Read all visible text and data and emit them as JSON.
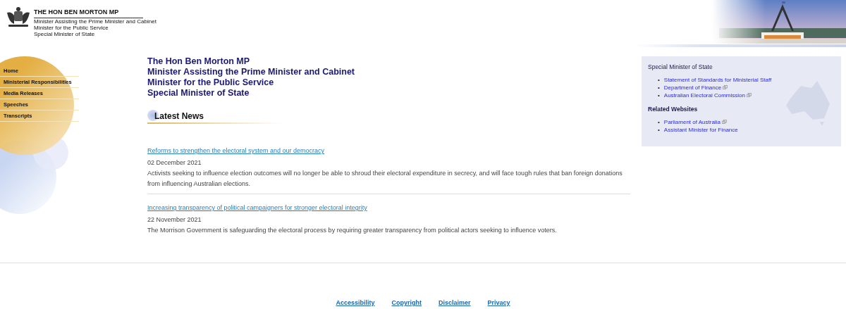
{
  "header": {
    "title": "THE HON BEN MORTON MP",
    "subtitles": [
      "Minister Assisting the Prime Minister and Cabinet",
      "Minister for the Public Service",
      "Special Minister of State"
    ]
  },
  "nav": [
    {
      "label": "Home"
    },
    {
      "label": "Ministerial Responsibilities"
    },
    {
      "label": "Media Releases"
    },
    {
      "label": "Speeches"
    },
    {
      "label": "Transcripts"
    }
  ],
  "main": {
    "titles": [
      "The Hon Ben Morton MP",
      "Minister Assisting the Prime Minister and Cabinet",
      "Minister for the Public Service",
      "Special Minister of State"
    ],
    "section_heading": "Latest News",
    "news": [
      {
        "title": "Reforms to strengthen the electoral system and our democracy",
        "date": "02 December 2021",
        "summary": "Activists seeking to influence election outcomes will no longer be able to shroud their electoral expenditure in secrecy, and will face tough rules that ban foreign donations from influencing Australian elections."
      },
      {
        "title": "Increasing transparency of political campaigners for stronger electoral integrity",
        "date": "22 November 2021",
        "summary": "The Morrison Government is safeguarding the electoral process by requiring greater transparency from political actors seeking to influence voters."
      }
    ]
  },
  "sidebar": {
    "groups": [
      {
        "heading": "Special Minister of State",
        "bold": false,
        "links": [
          {
            "bullet": "•",
            "label": "Statement of Standards for Ministerial Staff",
            "external": false
          },
          {
            "bullet": "•",
            "label": "Department of Finance",
            "external": true
          },
          {
            "bullet": "•",
            "label": "Australian Electoral Commission",
            "external": true
          }
        ]
      },
      {
        "heading": "Related Websites",
        "bold": true,
        "links": [
          {
            "bullet": "•",
            "label": "Parliament of Australia",
            "external": true
          },
          {
            "bullet": "•",
            "label": "Assistant Minister for Finance",
            "external": false
          }
        ]
      }
    ]
  },
  "footer": {
    "links": [
      "Accessibility",
      "Copyright",
      "Disclaimer",
      "Privacy"
    ]
  }
}
